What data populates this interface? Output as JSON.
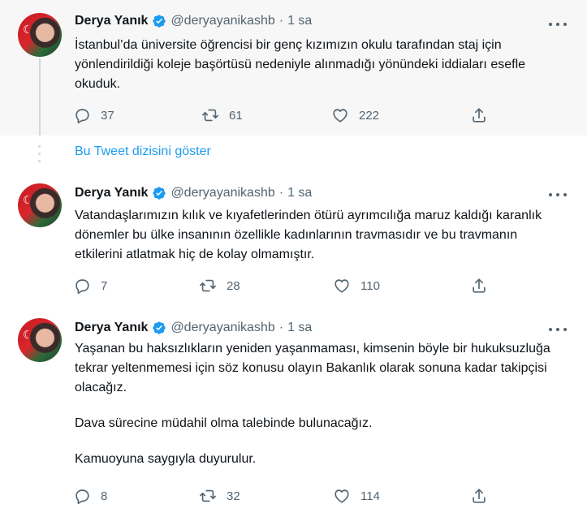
{
  "show_thread_label": "Bu Tweet dizisini göster",
  "tweets": [
    {
      "name": "Derya Yanık",
      "handle": "@deryayanikashb",
      "separator": "·",
      "time": "1 sa",
      "paragraphs": [
        "İstanbul’da üniversite öğrencisi bir genç kızımızın okulu tarafından staj için yönlendirildiği koleje başörtüsü nedeniyle alınmadığı yönündeki iddiaları esefle okuduk."
      ],
      "replies": "37",
      "retweets": "61",
      "likes": "222"
    },
    {
      "name": "Derya Yanık",
      "handle": "@deryayanikashb",
      "separator": "·",
      "time": "1 sa",
      "paragraphs": [
        "Vatandaşlarımızın kılık ve kıyafetlerinden ötürü ayrımcılığa maruz kaldığı karanlık dönemler bu ülke insanının özellikle kadınlarının travmasıdır ve bu travmanın etkilerini atlatmak hiç de kolay olmamıştır."
      ],
      "replies": "7",
      "retweets": "28",
      "likes": "110"
    },
    {
      "name": "Derya Yanık",
      "handle": "@deryayanikashb",
      "separator": "·",
      "time": "1 sa",
      "paragraphs": [
        "Yaşanan bu haksızlıkların yeniden yaşanmaması, kimsenin böyle bir hukuksuzluğa tekrar yeltenmemesi için söz konusu olayın Bakanlık olarak sonuna kadar takipçisi olacağız.",
        "Dava sürecine müdahil olma talebinde bulunacağız.",
        "Kamuoyuna saygıyla duyurulur."
      ],
      "replies": "8",
      "retweets": "32",
      "likes": "114"
    }
  ],
  "icons": {
    "verified": "verified-badge-icon",
    "reply": "reply-icon",
    "retweet": "retweet-icon",
    "like": "like-icon",
    "share": "share-icon",
    "more": "more-icon"
  },
  "colors": {
    "accent": "#1d9bf0",
    "secondary_text": "#536471",
    "highlight_bg": "#f7f7f7"
  }
}
